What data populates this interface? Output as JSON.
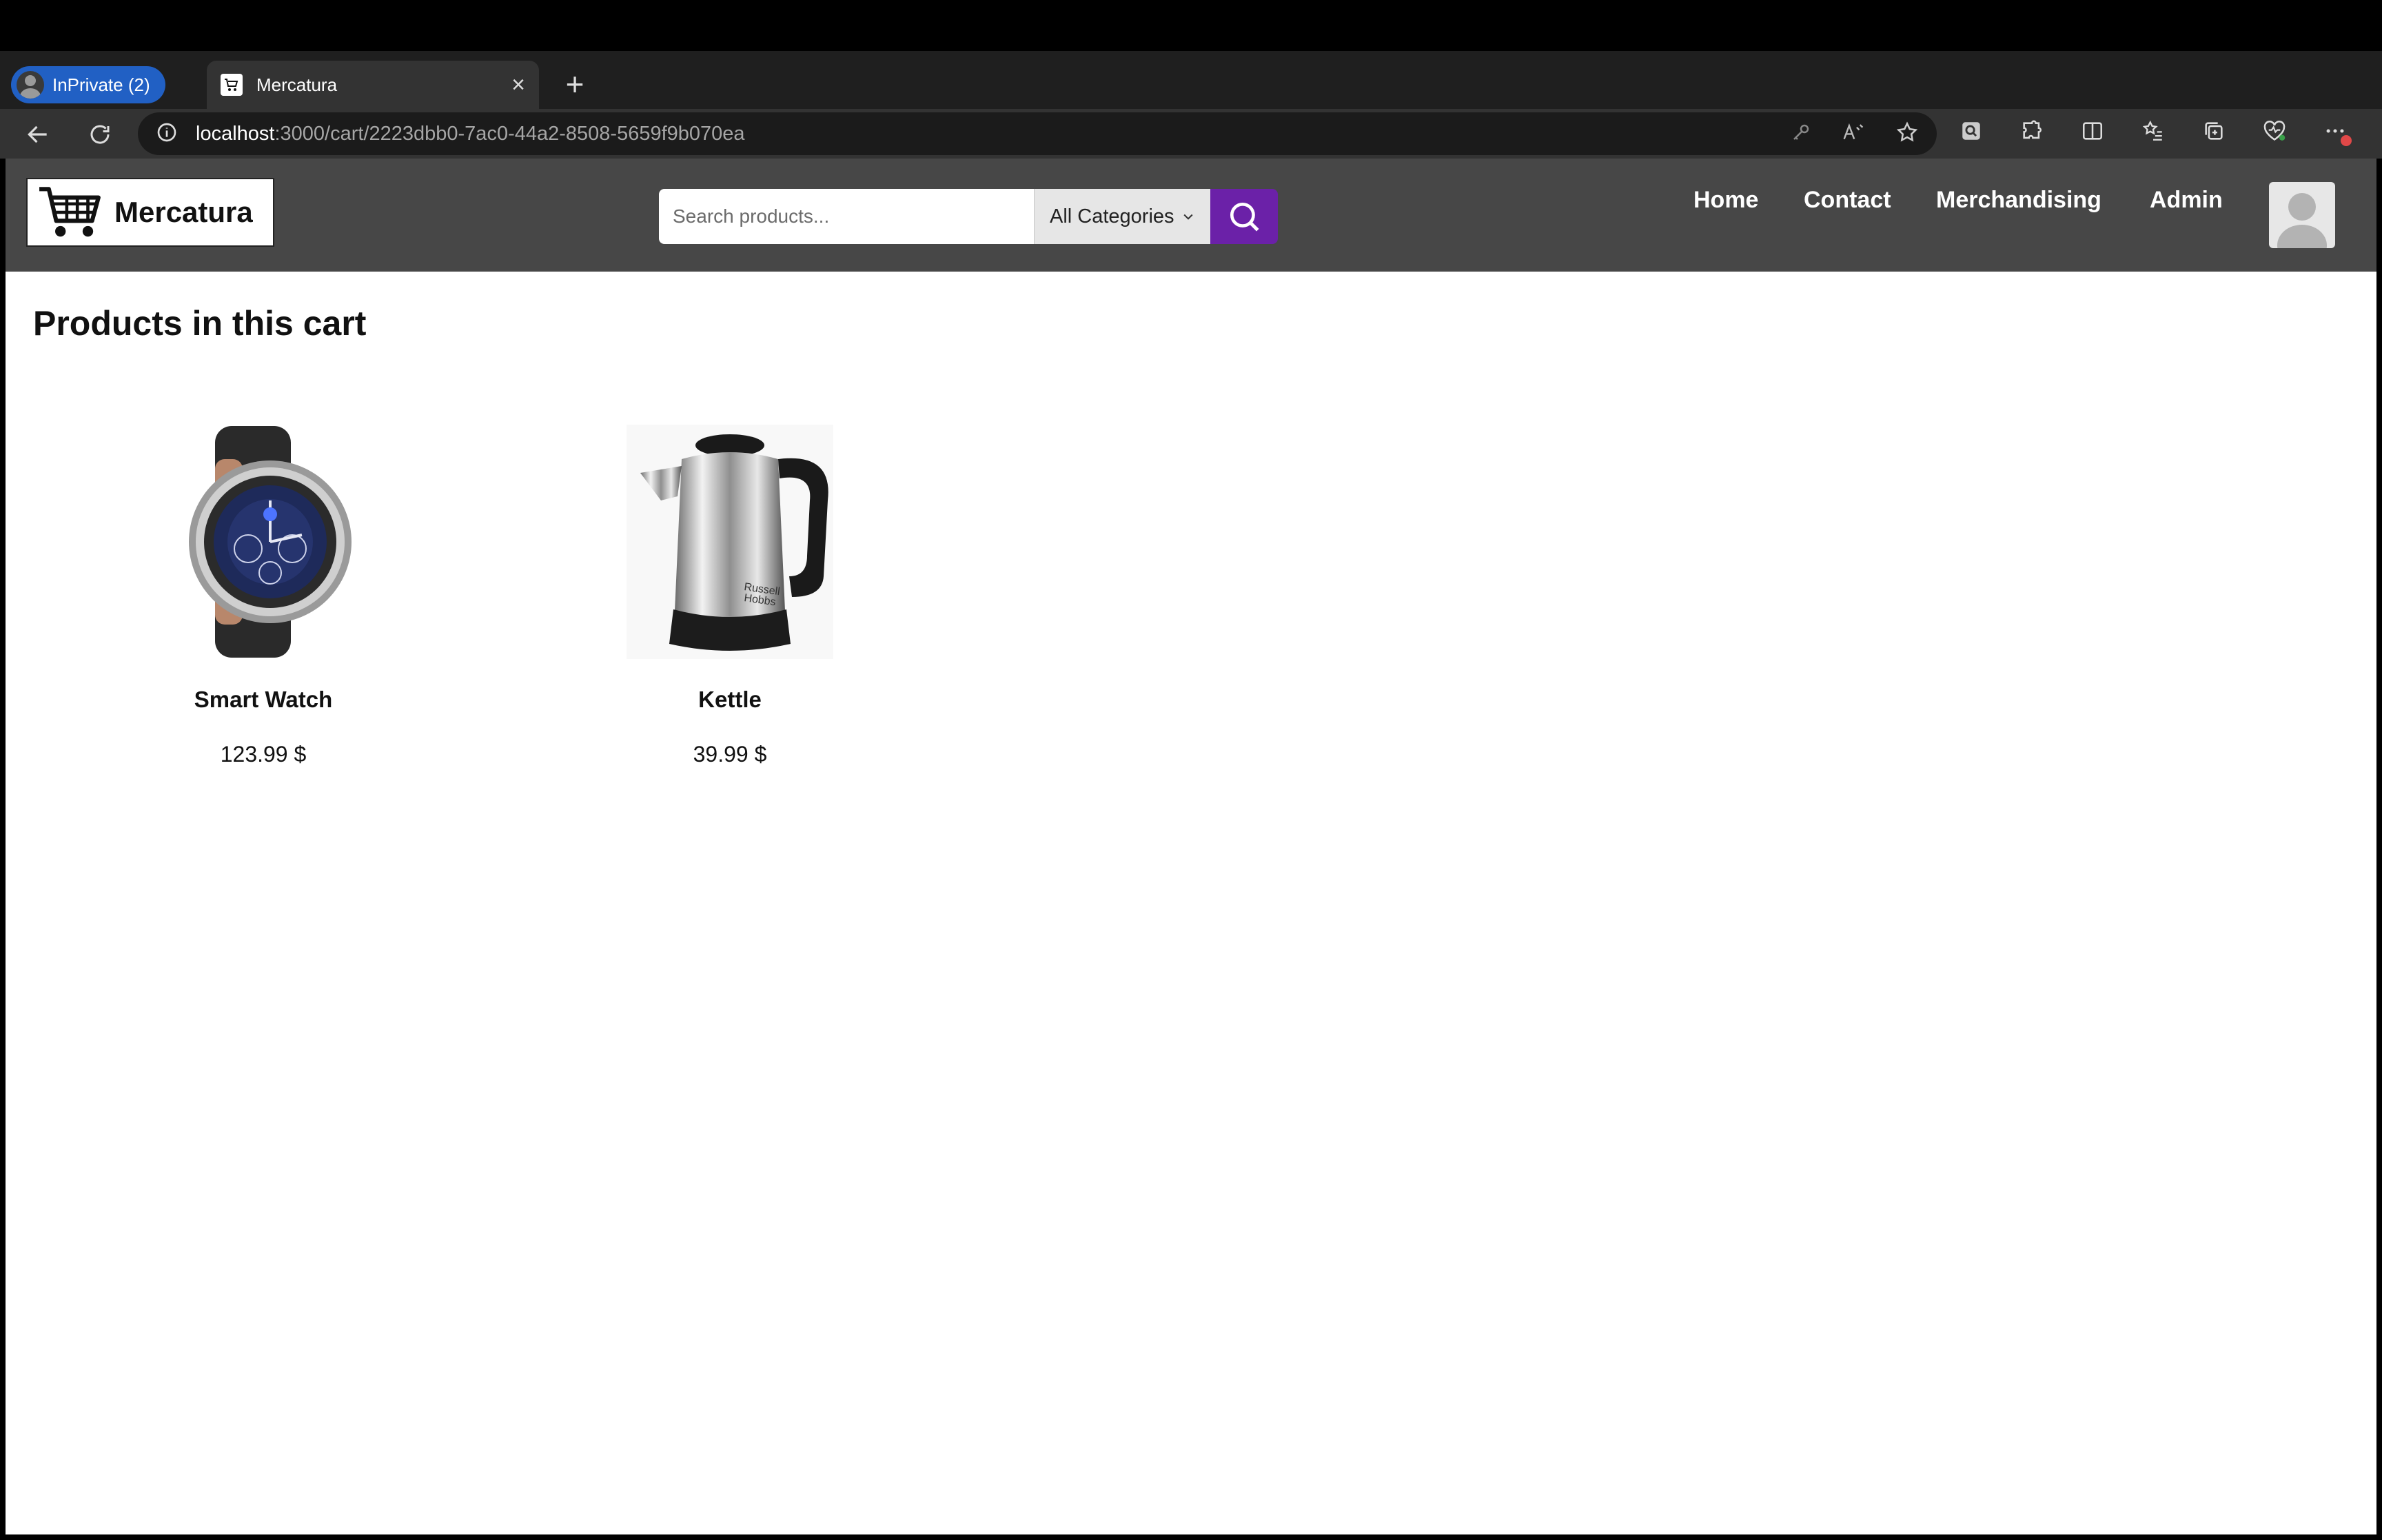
{
  "browser": {
    "profile_label": "InPrivate (2)",
    "tab_title": "Mercatura",
    "url_host": "localhost",
    "url_path": ":3000/cart/2223dbb0-7ac0-44a2-8508-5659f9b070ea"
  },
  "site": {
    "logo_text": "Mercatura",
    "search_placeholder": "Search products...",
    "category_selected": "All Categories",
    "nav": {
      "home": "Home",
      "contact": "Contact",
      "merchandising": "Merchandising",
      "admin": "Admin"
    }
  },
  "cart": {
    "title": "Products in this cart",
    "products": [
      {
        "name": "Smart Watch",
        "price": "123.99 $"
      },
      {
        "name": "Kettle",
        "price": "39.99 $"
      }
    ]
  },
  "colors": {
    "search_button": "#6b21a8",
    "header_bg": "#474747",
    "inprivate_badge": "#2160c4"
  }
}
